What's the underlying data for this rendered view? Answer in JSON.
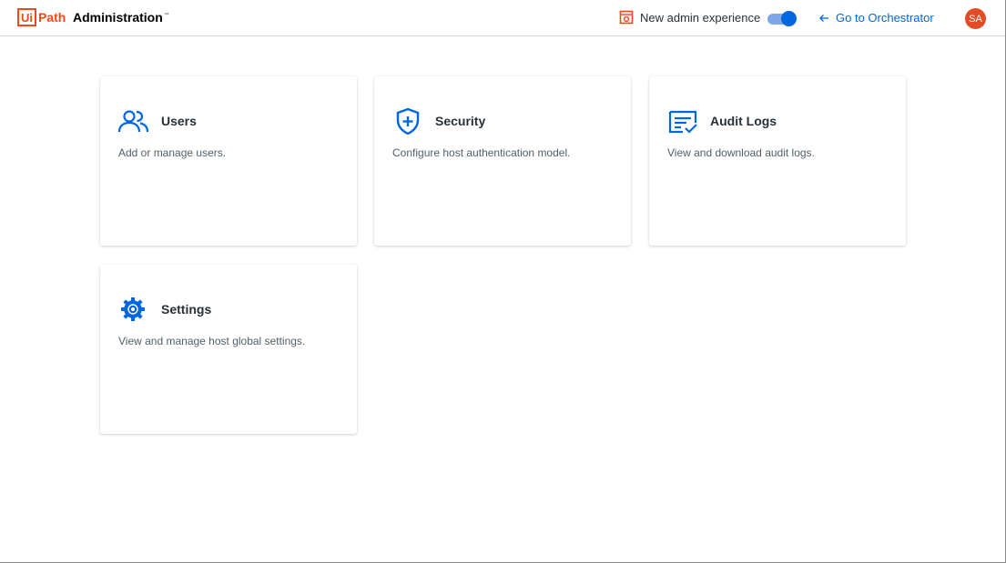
{
  "header": {
    "logo_ui": "Ui",
    "logo_path": "Path",
    "app_title": "Administration",
    "new_admin_label": "New admin experience",
    "goto_label": "Go to Orchestrator",
    "avatar_initials": "SA",
    "toggle_on": true
  },
  "colors": {
    "brand": "#fa4616",
    "accent": "#0067df",
    "avatar": "#e24b25"
  },
  "cards": [
    {
      "title": "Users",
      "description": "Add or manage users.",
      "icon": "users-icon"
    },
    {
      "title": "Security",
      "description": "Configure host authentication model.",
      "icon": "shield-icon"
    },
    {
      "title": "Audit Logs",
      "description": "View and download audit logs.",
      "icon": "audit-logs-icon"
    },
    {
      "title": "Settings",
      "description": "View and manage host global settings.",
      "icon": "gear-icon"
    }
  ]
}
